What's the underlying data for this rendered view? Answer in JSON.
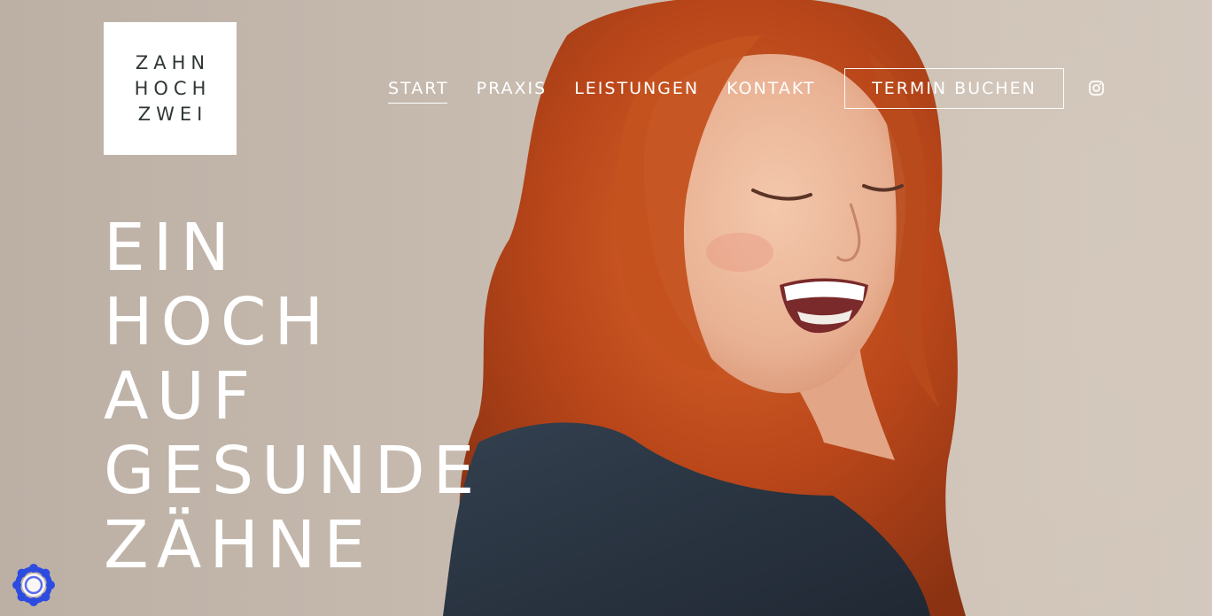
{
  "logo": {
    "line1": "ZAHN",
    "line2": "HOCH",
    "line3": "ZWEI"
  },
  "nav": {
    "items": [
      {
        "label": "START",
        "active": true
      },
      {
        "label": "PRAXIS",
        "active": false
      },
      {
        "label": "LEISTUNGEN",
        "active": false
      },
      {
        "label": "KONTAKT",
        "active": false
      }
    ],
    "cta_label": "TERMIN BUCHEN",
    "social_icon": "instagram-icon"
  },
  "hero": {
    "headline_lines": [
      "EIN",
      "HOCH",
      "AUF",
      "GESUNDE",
      "ZÄHNE"
    ]
  },
  "cookie_badge": {
    "icon": "cookie-settings-icon",
    "color": "#2c4be0"
  },
  "colors": {
    "text": "#ffffff",
    "logo_text": "#2f3734",
    "hair": "#c8531c",
    "shirt": "#2a3340"
  }
}
